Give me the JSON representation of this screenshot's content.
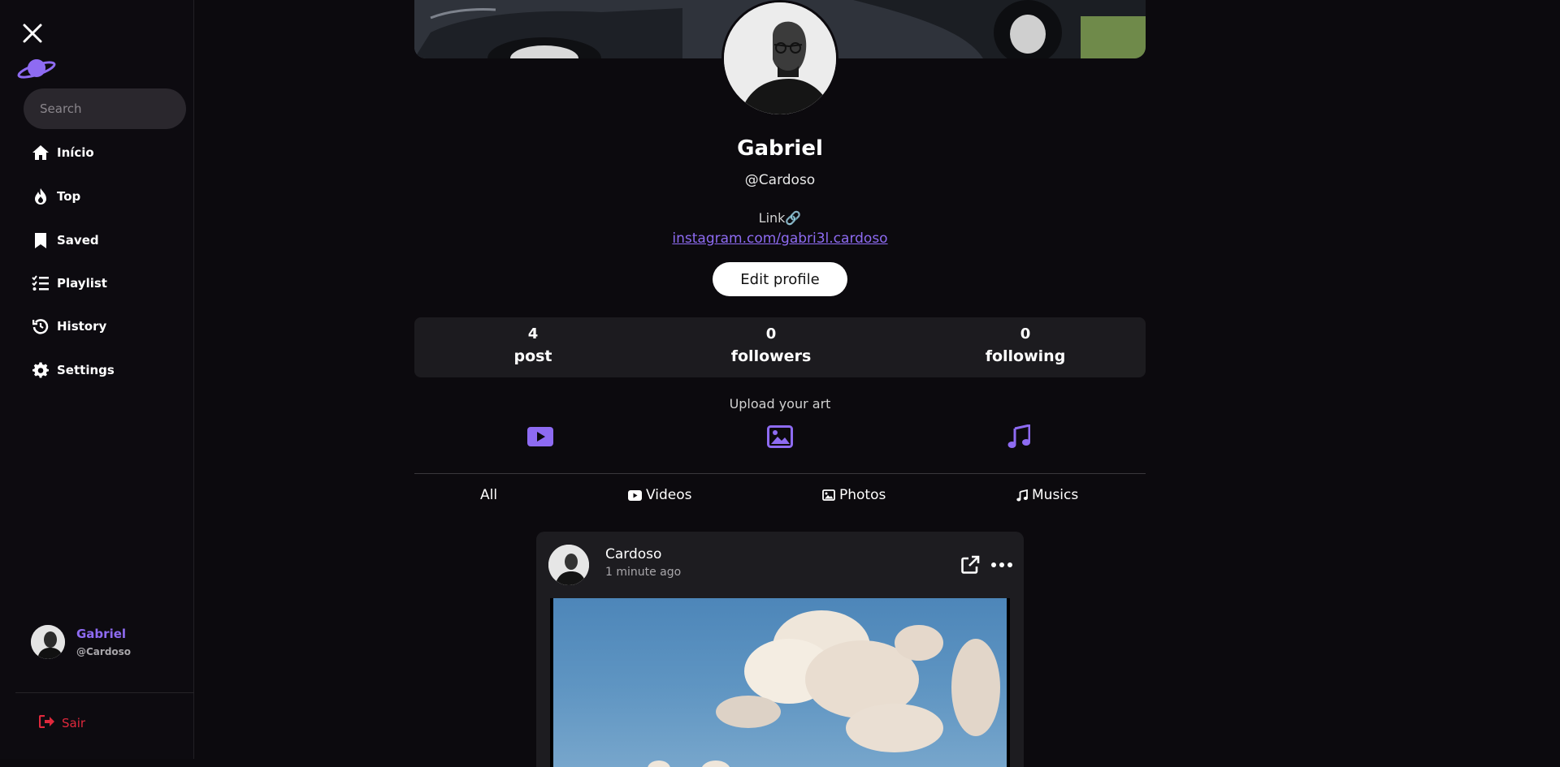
{
  "sidebar": {
    "search_placeholder": "Search",
    "items": [
      {
        "label": "Início",
        "icon": "home-icon"
      },
      {
        "label": "Top",
        "icon": "fire-icon"
      },
      {
        "label": "Saved",
        "icon": "bookmark-icon"
      },
      {
        "label": "Playlist",
        "icon": "list-check-icon"
      },
      {
        "label": "History",
        "icon": "history-icon"
      },
      {
        "label": "Settings",
        "icon": "gear-icon"
      }
    ],
    "user": {
      "name": "Gabriel",
      "handle": "@Cardoso"
    },
    "logout_label": "Sair"
  },
  "profile": {
    "name": "Gabriel",
    "handle": "@Cardoso",
    "link_label": "Link🔗",
    "link_url": "instagram.com/gabri3l.cardoso",
    "edit_label": "Edit profile"
  },
  "stats": [
    {
      "value": "4",
      "label": "post"
    },
    {
      "value": "0",
      "label": "followers"
    },
    {
      "value": "0",
      "label": "following"
    }
  ],
  "upload": {
    "label": "Upload your art"
  },
  "tabs": [
    {
      "label": "All"
    },
    {
      "label": "Videos"
    },
    {
      "label": "Photos"
    },
    {
      "label": "Musics"
    }
  ],
  "post": {
    "author": "Cardoso",
    "time": "1 minute ago"
  },
  "colors": {
    "accent": "#8e6bf2",
    "danger": "#e0283c",
    "background": "#0c0a0e",
    "card": "#1c1b1f"
  }
}
